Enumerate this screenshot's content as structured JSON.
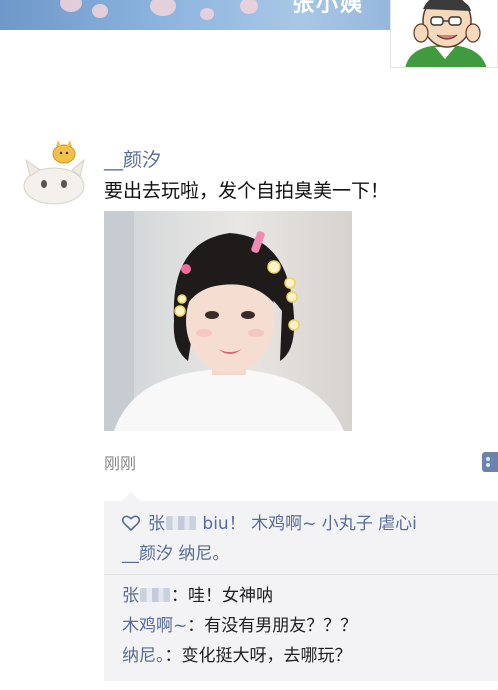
{
  "cover": {
    "owner_name": "张小姨"
  },
  "post": {
    "author": "__颜汐",
    "text": "要出去玩啦，发个自拍臭美一下！",
    "time": "刚刚"
  },
  "likes": {
    "parts": [
      "张",
      "biu！",
      "木鸡啊~",
      "小丸子",
      "虐心i",
      "__颜汐",
      "纳尼。"
    ]
  },
  "comments": [
    {
      "author": "张",
      "sep": "：",
      "text": "哇！女神呐",
      "author_redacted": true
    },
    {
      "author": "木鸡啊~",
      "sep": "：",
      "text": "有没有男朋友？？？",
      "author_redacted": false
    },
    {
      "author": "纳尼。",
      "sep": "：",
      "text": "变化挺大呀，去哪玩？",
      "author_redacted": false
    }
  ],
  "colors": {
    "name_link": "#576b95",
    "interaction_bg": "#f3f3f5",
    "time": "#8a8a8a"
  },
  "icons": [
    "heart-outline-icon",
    "more-actions-icon"
  ]
}
